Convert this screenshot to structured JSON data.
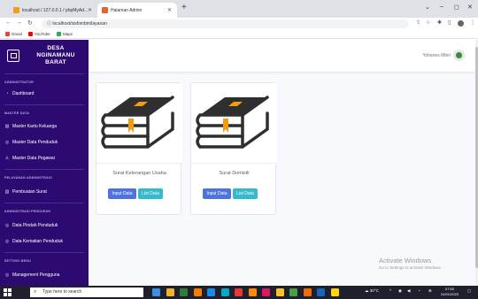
{
  "browser": {
    "tabs": [
      {
        "label": "localhost / 127.0.0.1 / phpMyAd...",
        "favicon_color": "#f29c1b"
      },
      {
        "label": "Halaman Admin",
        "favicon_color": "#e8632b"
      }
    ],
    "new_tab_symbol": "+",
    "window_controls": [
      "⌄",
      "–",
      "◻",
      "✕"
    ],
    "url": "localhost/sisfombm/layanan",
    "nav": {
      "back": "←",
      "forward": "→",
      "reload": "↻"
    },
    "bookmarks": [
      {
        "label": "Gmail",
        "color": "#ea4335"
      },
      {
        "label": "YouTube",
        "color": "#ff0000"
      },
      {
        "label": "Maps",
        "color": "#34a853"
      }
    ]
  },
  "sidebar": {
    "brand": {
      "line1": "DESA",
      "line2": "NGINAMANU",
      "line3": "BARAT"
    },
    "sections": [
      {
        "heading": "ADMINISTRATOR",
        "items": [
          {
            "label": "Dashboard",
            "icon": "◔"
          }
        ]
      },
      {
        "heading": "MASTER DATA",
        "items": [
          {
            "label": "Master Kartu Keluarga",
            "icon": "▤"
          },
          {
            "label": "Master Data Penduduk",
            "icon": "◎"
          },
          {
            "label": "Master Data Pegawai",
            "icon": "♙"
          }
        ]
      },
      {
        "heading": "PELAYANAN ADMINISTRASI",
        "items": [
          {
            "label": "Pembuatan Surat",
            "icon": "▥"
          }
        ]
      },
      {
        "heading": "ADMINISTRASI PENDUDUK",
        "items": [
          {
            "label": "Data Pindah Penduduk",
            "icon": "◎"
          },
          {
            "label": "Data Kematian Penduduk",
            "icon": "◎"
          }
        ]
      },
      {
        "heading": "SETTING MENU",
        "items": [
          {
            "label": "Management Pengguna",
            "icon": "◎"
          }
        ]
      }
    ]
  },
  "topbar": {
    "user_name": "Yohanes Mbiri"
  },
  "cards": [
    {
      "title": "Surat Keterangan Usaha",
      "input_label": "Input Data",
      "list_label": "List Data"
    },
    {
      "title": "Surat Domisili",
      "input_label": "Input Data",
      "list_label": "List Data"
    }
  ],
  "watermark": {
    "line1": "Activate Windows",
    "line2": "Go to Settings to activate Windows."
  },
  "taskbar": {
    "search_placeholder": "Type here to search",
    "apps": [
      "#3c8fe0",
      "#f0b429",
      "#2e7d32",
      "#f57c00",
      "#1e88e5",
      "#00acc1",
      "#e53935",
      "#fb8c00",
      "#d81b60",
      "#fbc02d",
      "#43a047",
      "#ef6c00",
      "#1565c0",
      "#ffd600"
    ],
    "weather": "30°C",
    "time": "07:50",
    "date": "24/01/2023"
  },
  "colors": {
    "sidebar": "#2c0a72",
    "primary": "#4e73df",
    "info": "#36b9cc",
    "book_dark": "#2f2f2f",
    "book_label": "#f39c12"
  }
}
